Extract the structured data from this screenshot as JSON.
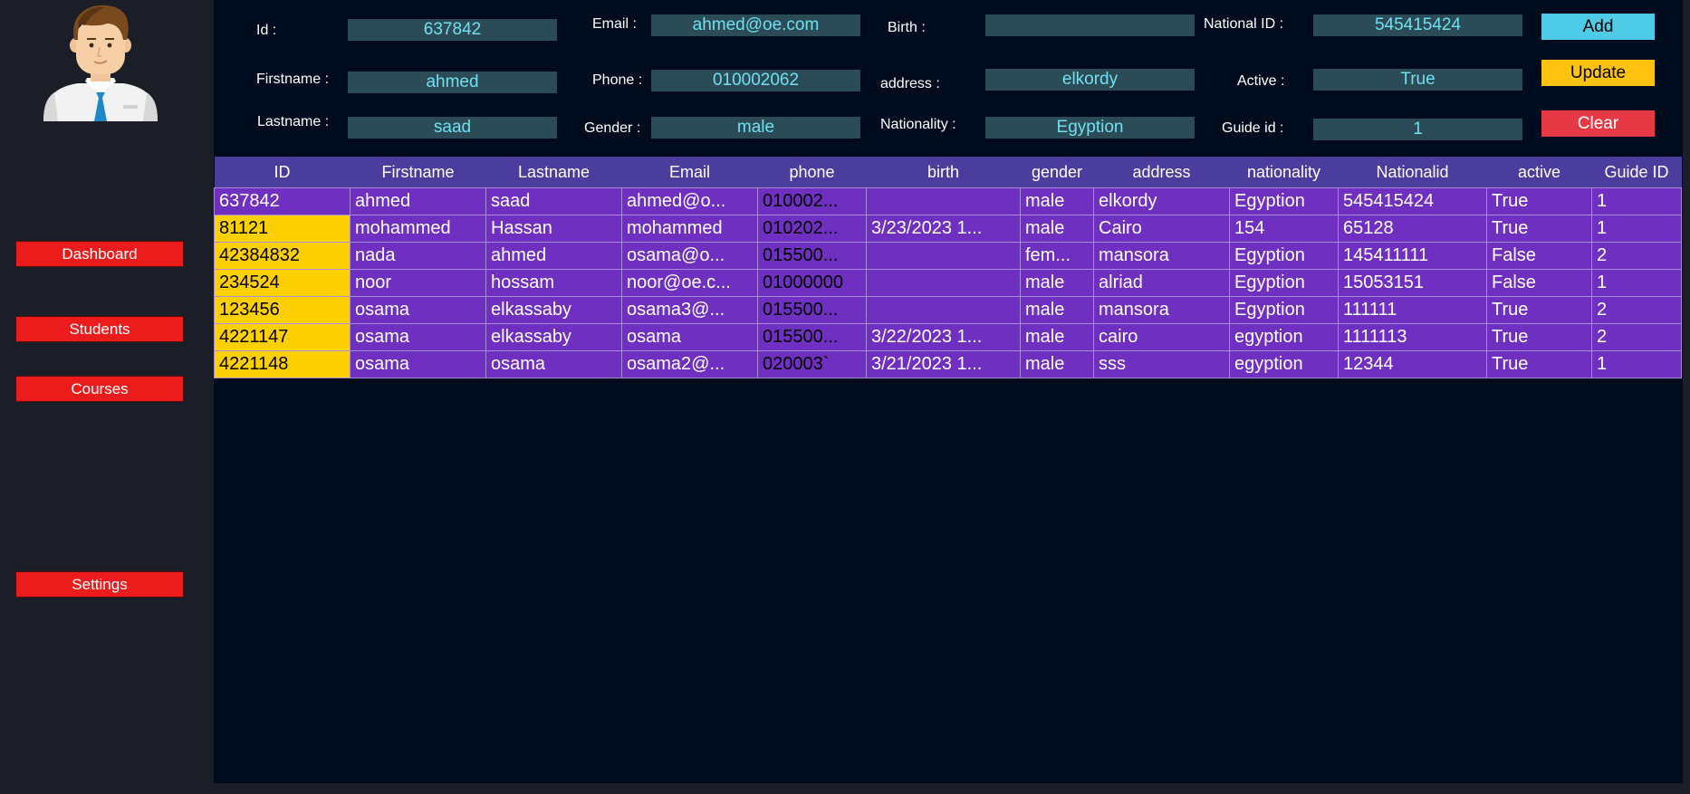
{
  "nav": {
    "dashboard": "Dashboard",
    "students": "Students",
    "courses": "Courses",
    "settings": "Settings"
  },
  "form": {
    "id": {
      "label": "Id :",
      "value": "637842"
    },
    "firstname": {
      "label": "Firstname :",
      "value": "ahmed"
    },
    "lastname": {
      "label": "Lastname :",
      "value": "saad"
    },
    "email": {
      "label": "Email :",
      "value": "ahmed@oe.com"
    },
    "phone": {
      "label": "Phone :",
      "value": "010002062"
    },
    "gender": {
      "label": "Gender :",
      "value": "male"
    },
    "birth": {
      "label": "Birth :",
      "value": ""
    },
    "address": {
      "label": "address :",
      "value": "elkordy"
    },
    "nationality": {
      "label": "Nationality :",
      "value": "Egyption"
    },
    "national_id": {
      "label": "National ID :",
      "value": "545415424"
    },
    "active": {
      "label": "Active :",
      "value": "True"
    },
    "guide_id": {
      "label": "Guide id :",
      "value": "1"
    }
  },
  "actions": {
    "add": "Add",
    "update": "Update",
    "clear": "Clear"
  },
  "table": {
    "columns": [
      "ID",
      "Firstname",
      "Lastname",
      "Email",
      "phone",
      "birth",
      "gender",
      "address",
      "nationality",
      "Nationalid",
      "active",
      "Guide ID"
    ],
    "rows": [
      [
        "637842",
        "ahmed",
        "saad",
        "ahmed@o...",
        "010002...",
        "",
        "male",
        "elkordy",
        "Egyption",
        "545415424",
        "True",
        "1"
      ],
      [
        "81121",
        "mohammed",
        "Hassan",
        "mohammed",
        "010202...",
        "3/23/2023 1...",
        "male",
        "Cairo",
        "154",
        "65128",
        "True",
        "1"
      ],
      [
        "42384832",
        "nada",
        "ahmed",
        "osama@o...",
        "015500...",
        "",
        "fem...",
        "mansora",
        "Egyption",
        "145411111",
        "False",
        "2"
      ],
      [
        "234524",
        "noor",
        "hossam",
        "noor@oe.c...",
        "01000000",
        "",
        "male",
        "alriad",
        "Egyption",
        "15053151",
        "False",
        "1"
      ],
      [
        "123456",
        "osama",
        "elkassaby",
        "osama3@...",
        "015500...",
        "",
        "male",
        "mansora",
        "Egyption",
        "111111",
        "True",
        "2"
      ],
      [
        "4221147",
        "osama",
        "elkassaby",
        "osama",
        "015500...",
        "3/22/2023 1...",
        "male",
        "cairo",
        "egyption",
        "1111113",
        "True",
        "2"
      ],
      [
        "4221148",
        "osama",
        "osama",
        "osama2@...",
        "020003`",
        "3/21/2023 1...",
        "male",
        "sss",
        "egyption",
        "12344",
        "True",
        "1"
      ]
    ]
  },
  "colors": {
    "sidebar_bg": "#1b1e26",
    "main_bg": "#000c1e",
    "nav_button": "#ed1c1c",
    "field_bg": "#2b4b57",
    "field_text": "#6fe0f0",
    "add_button": "#4ecbe6",
    "update_button": "#ffc20e",
    "clear_button": "#e63946",
    "grid_header": "#4b3d9e",
    "grid_row": "#6f2fc0",
    "grid_id_cell": "#ffd000"
  }
}
